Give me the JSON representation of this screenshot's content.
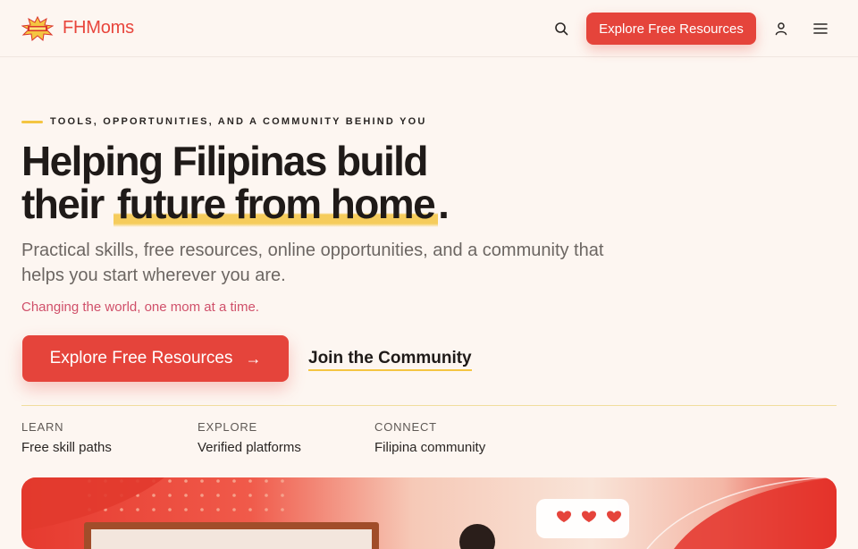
{
  "header": {
    "brand": "FHMoms",
    "cta": "Explore Free Resources",
    "icons": [
      "logo-burst",
      "search-icon",
      "user-icon",
      "menu-icon"
    ]
  },
  "hero": {
    "eyebrow": "TOOLS, OPPORTUNITIES, AND A COMMUNITY BEHIND YOU",
    "title_line1": "Helping Filipinas build",
    "title_line2_start": "their",
    "title_highlight": "future from home",
    "title_end": ".",
    "subtitle": "Practical skills, free resources, online opportunities, and a community that helps you start wherever you are.",
    "tagline": "Changing the world, one mom at a time.",
    "primary_button": "Explore Free Resources",
    "primary_button_icon": "→",
    "secondary_link": "Join the Community"
  },
  "stats": [
    {
      "label": "LEARN",
      "value": "Free skill paths"
    },
    {
      "label": "EXPLORE",
      "value": "Verified platforms"
    },
    {
      "label": "CONNECT",
      "value": "Filipina community"
    }
  ],
  "colors": {
    "background": "#fdf6f1",
    "accent_red": "#e5443b",
    "highlight_yellow": "#f4c542",
    "tagline_pink": "#d0506a",
    "text_dark": "#1f1a18"
  }
}
